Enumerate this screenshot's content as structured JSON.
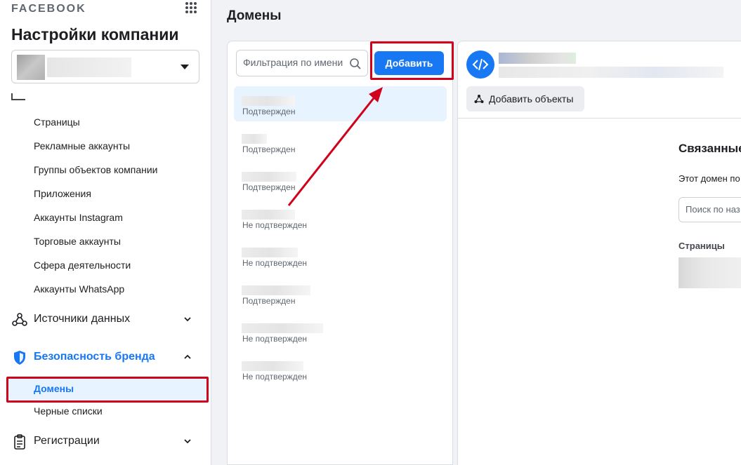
{
  "sidebar": {
    "brand": "FACEBOOK",
    "company_title": "Настройки компании",
    "items": [
      {
        "label": "Страницы"
      },
      {
        "label": "Рекламные аккаунты"
      },
      {
        "label": "Группы объектов компании"
      },
      {
        "label": "Приложения"
      },
      {
        "label": "Аккаунты Instagram"
      },
      {
        "label": "Торговые аккаунты"
      },
      {
        "label": "Сфера деятельности"
      },
      {
        "label": "Аккаунты WhatsApp"
      }
    ],
    "sections": {
      "data_sources": "Источники данных",
      "brand_safety": "Безопасность бренда",
      "registrations": "Регистрации"
    },
    "brand_safety_items": {
      "domains": "Домены",
      "blocklists": "Черные списки"
    }
  },
  "main": {
    "title": "Домены",
    "search_placeholder": "Фильтрация по имени",
    "add_label": "Добавить",
    "domains": [
      {
        "status": "Подтвержден"
      },
      {
        "status": "Подтвержден"
      },
      {
        "status": "Подтвержден"
      },
      {
        "status": "Не подтвержден"
      },
      {
        "status": "Не подтвержден"
      },
      {
        "status": "Подтвержден"
      },
      {
        "status": "Не подтвержден"
      },
      {
        "status": "Не подтвержден"
      }
    ]
  },
  "detail": {
    "add_objects_label": "Добавить объекты",
    "linked_title": "Связанные",
    "linked_desc": "Этот домен по",
    "search_placeholder": "Поиск по наз",
    "pages_label": "Страницы"
  },
  "colors": {
    "accent": "#1877f2",
    "highlight_red": "#d0021b",
    "selected_bg": "#e7f3ff"
  }
}
